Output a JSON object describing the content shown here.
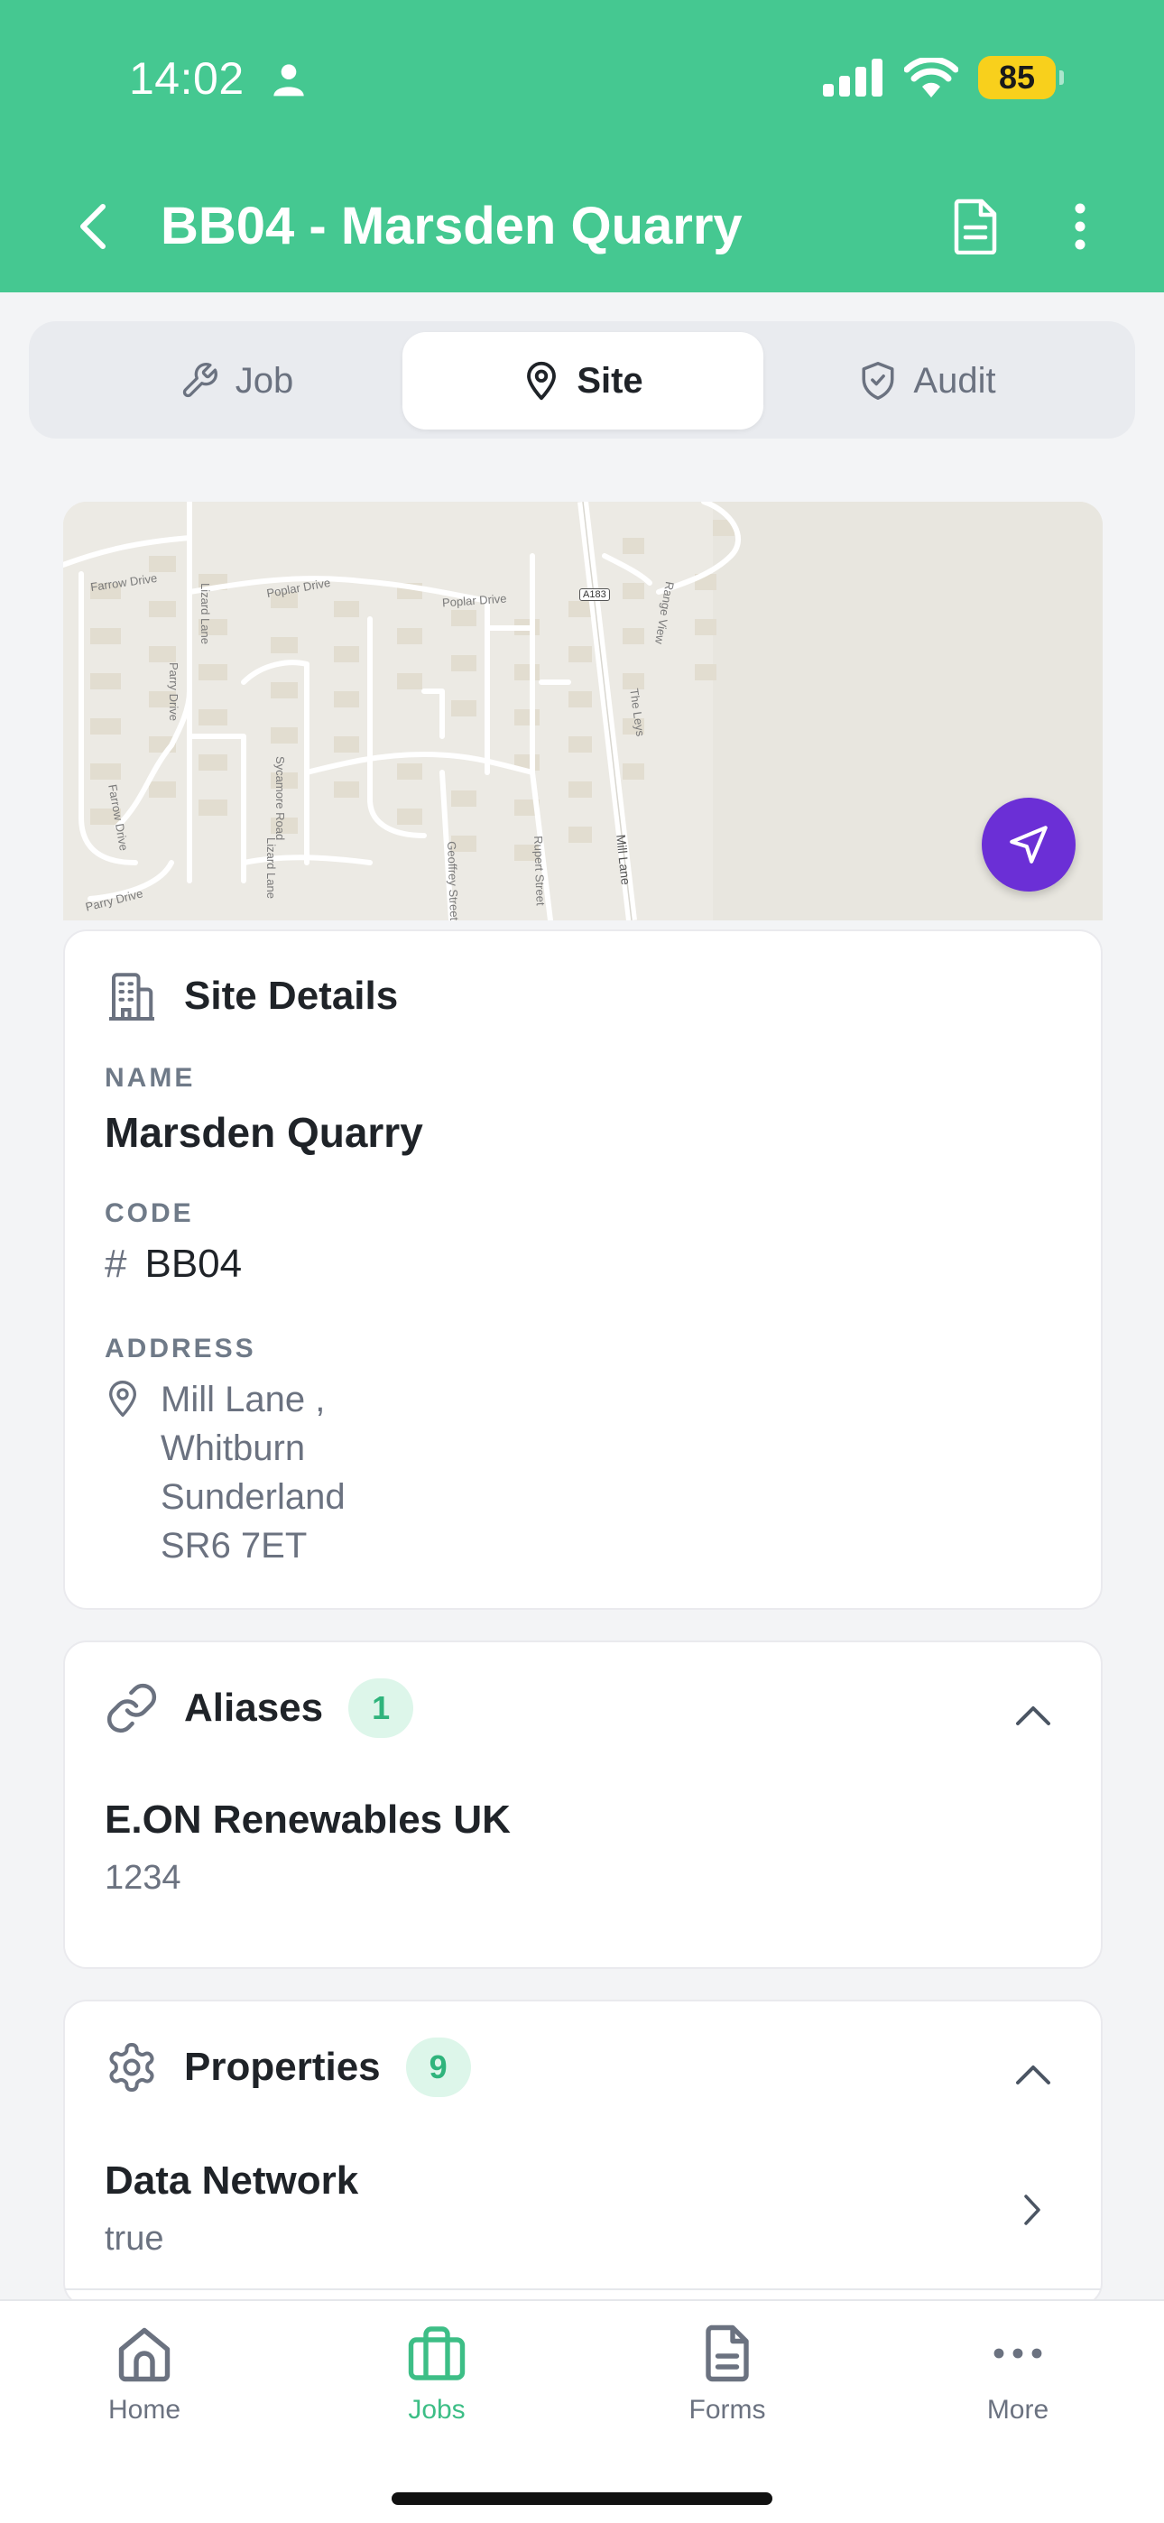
{
  "status_bar": {
    "time": "14:02",
    "battery": "85"
  },
  "header": {
    "title": "BB04 - Marsden Quarry"
  },
  "tabs": [
    {
      "label": "Job",
      "icon": "wrench-icon",
      "active": false
    },
    {
      "label": "Site",
      "icon": "map-pin-icon",
      "active": true
    },
    {
      "label": "Audit",
      "icon": "shield-icon",
      "active": false
    }
  ],
  "map": {
    "labels": [
      "Farrow Drive",
      "Lizard Lane",
      "Poplar Drive",
      "Poplar Drive",
      "A183",
      "Range View",
      "Parry Drive",
      "The Leys",
      "Farrow Drive",
      "Sycamore Road",
      "Parry Drive",
      "Lizard Lane",
      "Geoffrey Street",
      "Rupert Street",
      "Mill Lane"
    ]
  },
  "site_details": {
    "title": "Site Details",
    "name_label": "NAME",
    "name": "Marsden Quarry",
    "code_label": "CODE",
    "code_symbol": "#",
    "code": "BB04",
    "address_label": "ADDRESS",
    "address_lines": [
      "Mill Lane ,",
      "Whitburn",
      "Sunderland",
      "SR6 7ET"
    ]
  },
  "aliases": {
    "title": "Aliases",
    "count": "1",
    "items": [
      {
        "name": "E.ON Renewables UK",
        "code": "1234"
      }
    ]
  },
  "properties": {
    "title": "Properties",
    "count": "9",
    "items": [
      {
        "name": "Data Network",
        "value": "true"
      }
    ]
  },
  "bottom_nav": [
    {
      "label": "Home",
      "icon": "home-icon",
      "active": false
    },
    {
      "label": "Jobs",
      "icon": "briefcase-icon",
      "active": true
    },
    {
      "label": "Forms",
      "icon": "document-icon",
      "active": false
    },
    {
      "label": "More",
      "icon": "ellipsis-icon",
      "active": false
    }
  ],
  "colors": {
    "accent": "#45C891",
    "fab": "#6B2FD6",
    "badge_bg": "#DDF6EA",
    "battery": "#F8D01C"
  }
}
